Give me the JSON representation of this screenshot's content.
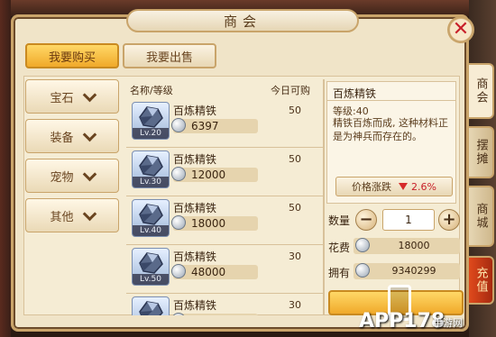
{
  "window": {
    "title": "商会"
  },
  "tabs": {
    "buy": "我要购买",
    "sell": "我要出售"
  },
  "categories": [
    "宝石",
    "装备",
    "宠物",
    "其他"
  ],
  "list_header": {
    "name": "名称/等级",
    "limit": "今日可购"
  },
  "items": [
    {
      "name": "百炼精铁",
      "level": "Lv.20",
      "price": "6397",
      "limit": "50"
    },
    {
      "name": "百炼精铁",
      "level": "Lv.30",
      "price": "12000",
      "limit": "50"
    },
    {
      "name": "百炼精铁",
      "level": "Lv.40",
      "price": "18000",
      "limit": "50"
    },
    {
      "name": "百炼精铁",
      "level": "Lv.50",
      "price": "48000",
      "limit": "30"
    },
    {
      "name": "百炼精铁",
      "level": "",
      "price": "",
      "limit": "30"
    }
  ],
  "detail": {
    "title": "百炼精铁",
    "level": "等级:40",
    "description": "精铁百炼而成, 这种材料正是为神兵而存在的。",
    "trend_label": "价格涨跌",
    "trend_value": "2.6%"
  },
  "purchase": {
    "qty_label": "数量",
    "qty_value": "1",
    "cost_label": "花费",
    "cost_value": "18000",
    "own_label": "拥有",
    "own_value": "9340299"
  },
  "side_tabs": [
    "商会",
    "摆摊",
    "商城",
    "充值"
  ],
  "watermark": {
    "main": "APP178",
    "sub": "手游网"
  },
  "colors": {
    "accent": "#f0a92a",
    "panel": "#f0e4c8",
    "down_red": "#d62a2a"
  }
}
